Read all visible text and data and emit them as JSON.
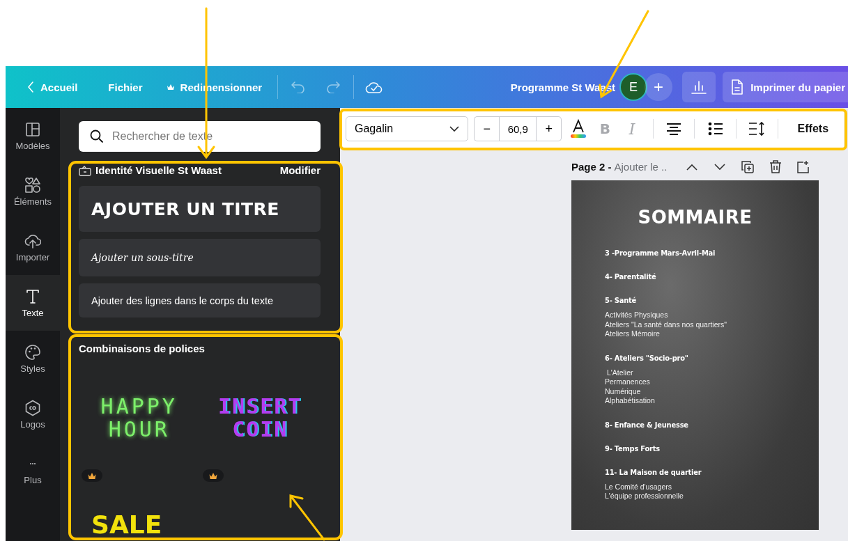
{
  "topbar": {
    "back": "Accueil",
    "menu": [
      "Fichier",
      "Redimensionner"
    ],
    "title": "Programme St Waast",
    "avatar": "E",
    "add": "+",
    "print": "Imprimer du papier"
  },
  "rail": [
    {
      "label": "Modèles",
      "selected": false
    },
    {
      "label": "Éléments",
      "selected": false
    },
    {
      "label": "Importer",
      "selected": false
    },
    {
      "label": "Texte",
      "selected": true
    },
    {
      "label": "Styles",
      "selected": false
    },
    {
      "label": "Logos",
      "selected": false
    },
    {
      "label": "Plus",
      "selected": false
    }
  ],
  "panel": {
    "search": {
      "placeholder": "Rechercher de texte"
    },
    "brand": {
      "title": "Identité Visuelle St Waast",
      "action": "Modifier"
    },
    "styles": [
      {
        "kind": "title",
        "text": "AJOUTER UN TITRE"
      },
      {
        "kind": "subtitle",
        "text": "Ajouter un sous-titre"
      },
      {
        "kind": "body",
        "text": "Ajouter des lignes dans le corps du texte"
      }
    ],
    "combos_title": "Combinaisons de polices",
    "combos": [
      {
        "kind": "neon",
        "lines": [
          "HAPPY",
          "HOUR"
        ],
        "color": "#7df06a",
        "premium": true
      },
      {
        "kind": "pixel",
        "lines": [
          "INSERT",
          "COIN"
        ],
        "color": "#b43cf0",
        "premium": true
      },
      {
        "kind": "bold",
        "lines": [
          "SALE"
        ],
        "color": "#f2e20c"
      }
    ]
  },
  "toolbar": {
    "font": "Gagalin",
    "minus": "−",
    "size": "60,9",
    "plus": "+",
    "bold": {
      "label": "B",
      "disabled": true
    },
    "italic": {
      "label": "I",
      "disabled": true
    },
    "effects": "Effets"
  },
  "page_header": {
    "page": "Page 2 -",
    "title": "Ajouter le .."
  },
  "document": {
    "title": "SOMMAIRE",
    "sections": [
      {
        "heading": "3 -Programme Mars-Avril-Mai"
      },
      {
        "heading": "4- Parentalité"
      },
      {
        "heading": "5- Santé",
        "items": [
          "Activités Physiques",
          "Ateliers \"La santé dans nos quartiers\"",
          "Ateliers Mémoire"
        ]
      },
      {
        "heading": "6- Ateliers \"Socio-pro\"",
        "items": [
          " L'Atelier",
          "Permanences",
          "Numérique",
          "Alphabétisation"
        ]
      },
      {
        "heading": "8- Enfance & Jeunesse"
      },
      {
        "heading": "9- Temps Forts"
      },
      {
        "heading": "11- La Maison de quartier",
        "items": [
          "Le Comité d'usagers",
          "L'équipe professionnelle"
        ]
      }
    ]
  }
}
